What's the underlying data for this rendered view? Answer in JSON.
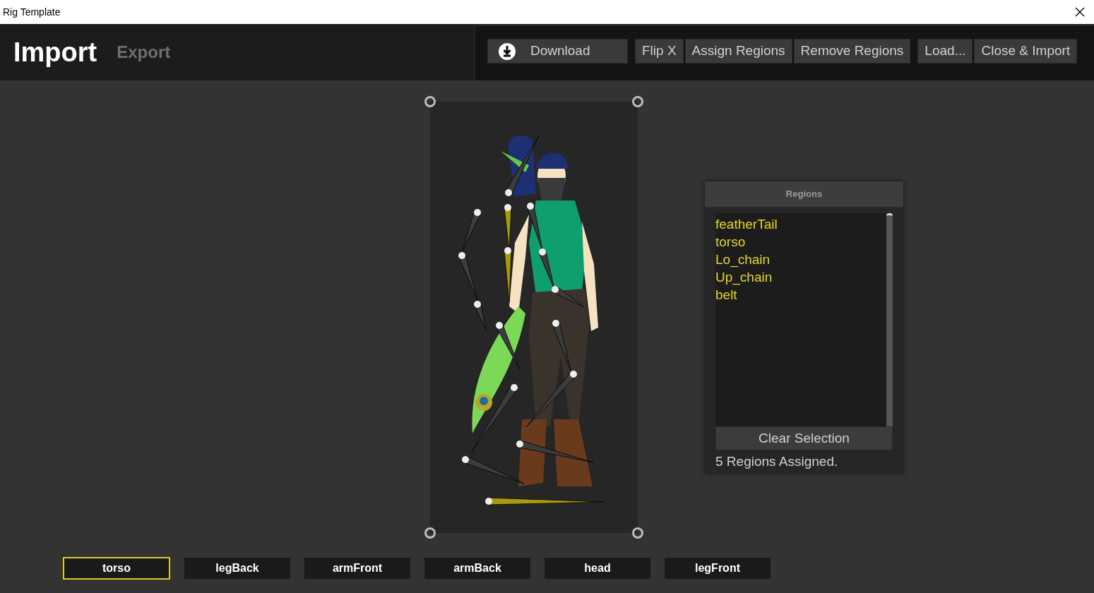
{
  "window": {
    "title": "Rig Template"
  },
  "mode_tabs": [
    {
      "label": "Import",
      "selected": true
    },
    {
      "label": "Export",
      "selected": false
    }
  ],
  "toolbar_groups": [
    {
      "buttons": [
        {
          "label": "Download",
          "kind": "icon"
        }
      ]
    },
    {
      "buttons": [
        {
          "label": "Flip X",
          "kind": "text"
        },
        {
          "label": "Assign Regions",
          "kind": "text"
        },
        {
          "label": "Remove Regions",
          "kind": "text"
        }
      ]
    },
    {
      "buttons": [
        {
          "label": "Load...",
          "kind": "text"
        },
        {
          "label": "Close & Import",
          "kind": "text"
        }
      ]
    }
  ],
  "regions_panel": {
    "title": "Regions",
    "items": [
      "featherTail",
      "torso",
      "Lo_chain",
      "Up_chain",
      "belt"
    ],
    "clear_button": "Clear Selection",
    "status": "5 Regions Assigned."
  },
  "part_tabs": [
    {
      "label": "torso",
      "selected": true
    },
    {
      "label": "legBack",
      "selected": false
    },
    {
      "label": "armFront",
      "selected": false
    },
    {
      "label": "armBack",
      "selected": false
    },
    {
      "label": "head",
      "selected": false
    },
    {
      "label": "legFront",
      "selected": false
    }
  ]
}
